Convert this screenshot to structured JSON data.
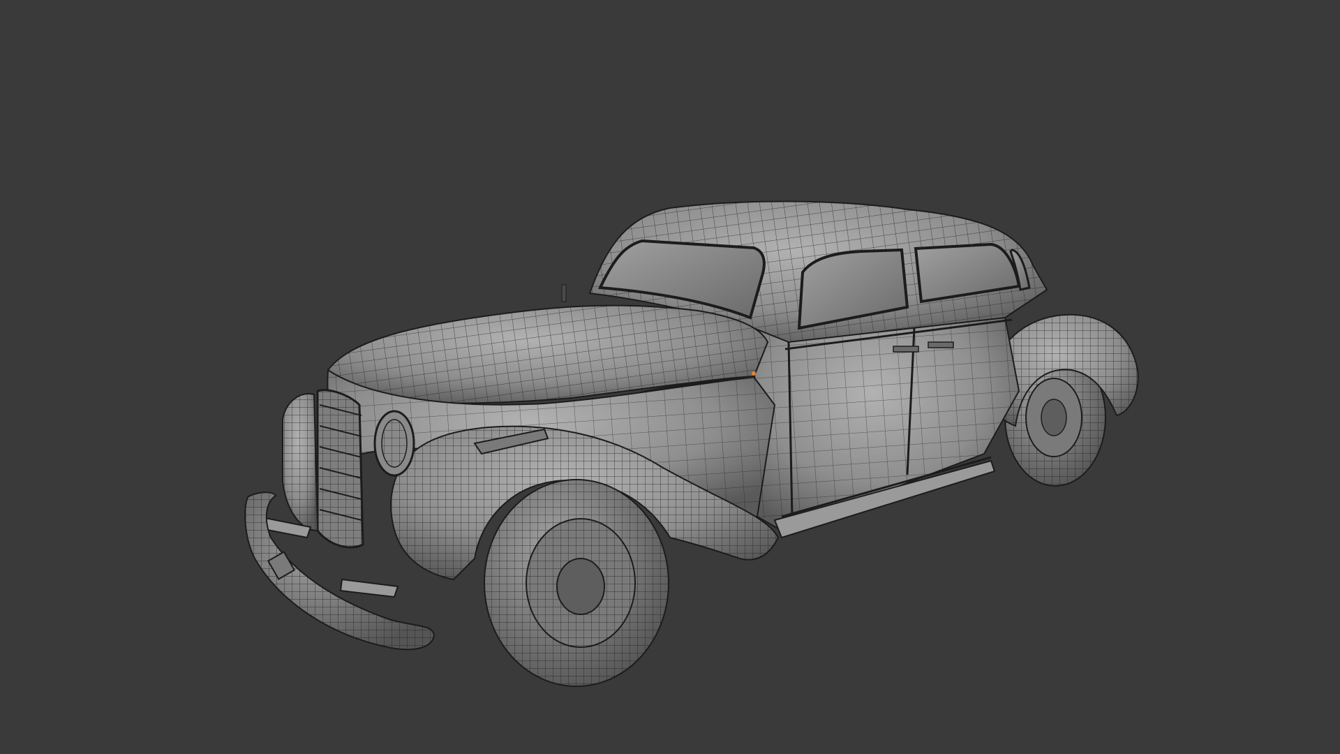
{
  "viewport": {
    "background_color": "#3a3a3a",
    "shading_mode": "wireframe-solid",
    "model": {
      "name_icon": "vintage-sedan-mesh",
      "base_color": "#8e8e8e",
      "highlight_color": "#b2b2b2",
      "shadow_color": "#5a5a5a",
      "wire_color": "#1c1c1c",
      "accent_color": "#e0872a"
    }
  }
}
